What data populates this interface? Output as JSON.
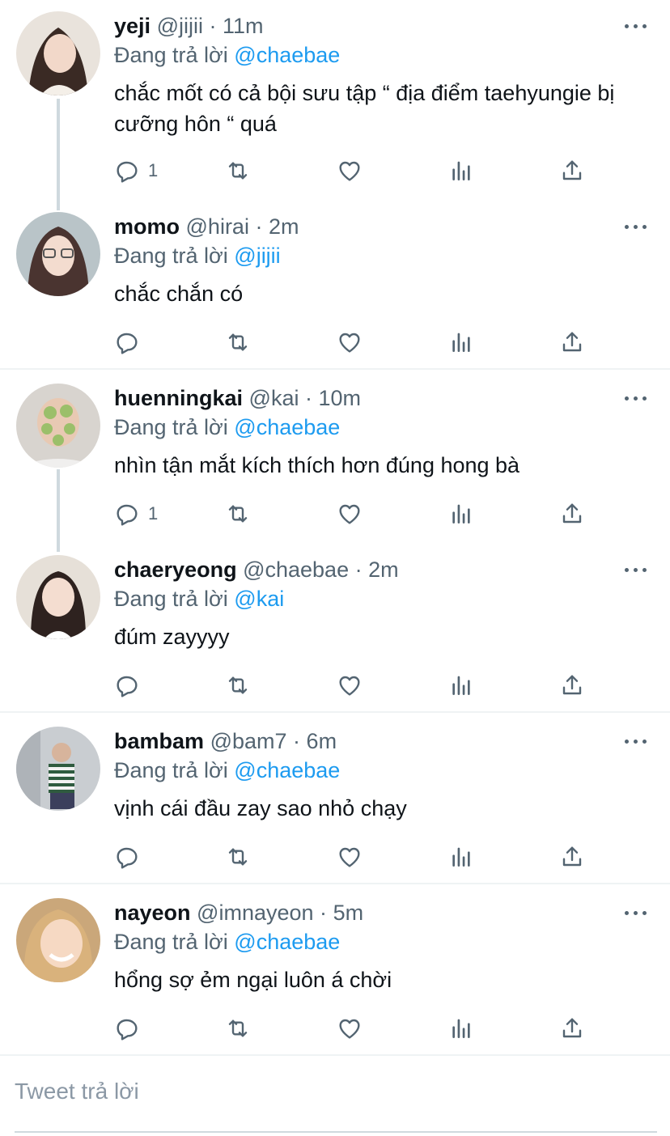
{
  "colors": {
    "text": "#0f1419",
    "muted": "#536471",
    "link": "#1d9bf0"
  },
  "replying_label": "Đang trả lời",
  "tweets": [
    {
      "name": "yeji",
      "handle": "@jijii",
      "time": "11m",
      "reply_to": "@chaebae",
      "text": "chắc mốt có cả bội sưu tập “ địa điểm taehyungie bị cưỡng hôn “ quá",
      "reply_count": "1"
    },
    {
      "name": "momo",
      "handle": "@hirai",
      "time": "2m",
      "reply_to": "@jijii",
      "text": "chắc chắn có",
      "reply_count": ""
    },
    {
      "name": "huenningkai",
      "handle": "@kai",
      "time": "10m",
      "reply_to": "@chaebae",
      "text": "nhìn tận mắt kích thích hơn đúng hong bà",
      "reply_count": "1"
    },
    {
      "name": "chaeryeong",
      "handle": "@chaebae",
      "time": "2m",
      "reply_to": "@kai",
      "text": "đúm zayyyy",
      "reply_count": ""
    },
    {
      "name": "bambam",
      "handle": "@bam7",
      "time": "6m",
      "reply_to": "@chaebae",
      "text": "vịnh cái đầu zay sao nhỏ chạy",
      "reply_count": ""
    },
    {
      "name": "nayeon",
      "handle": "@imnayeon",
      "time": "5m",
      "reply_to": "@chaebae",
      "text": "hổng sợ ẻm ngại luôn á chời",
      "reply_count": ""
    }
  ],
  "compose": {
    "placeholder": "Tweet trả lời"
  },
  "icons": {
    "more": "more-horizontal-icon",
    "reply": "reply-icon",
    "retweet": "retweet-icon",
    "like": "heart-icon",
    "views": "analytics-icon",
    "share": "share-icon"
  }
}
